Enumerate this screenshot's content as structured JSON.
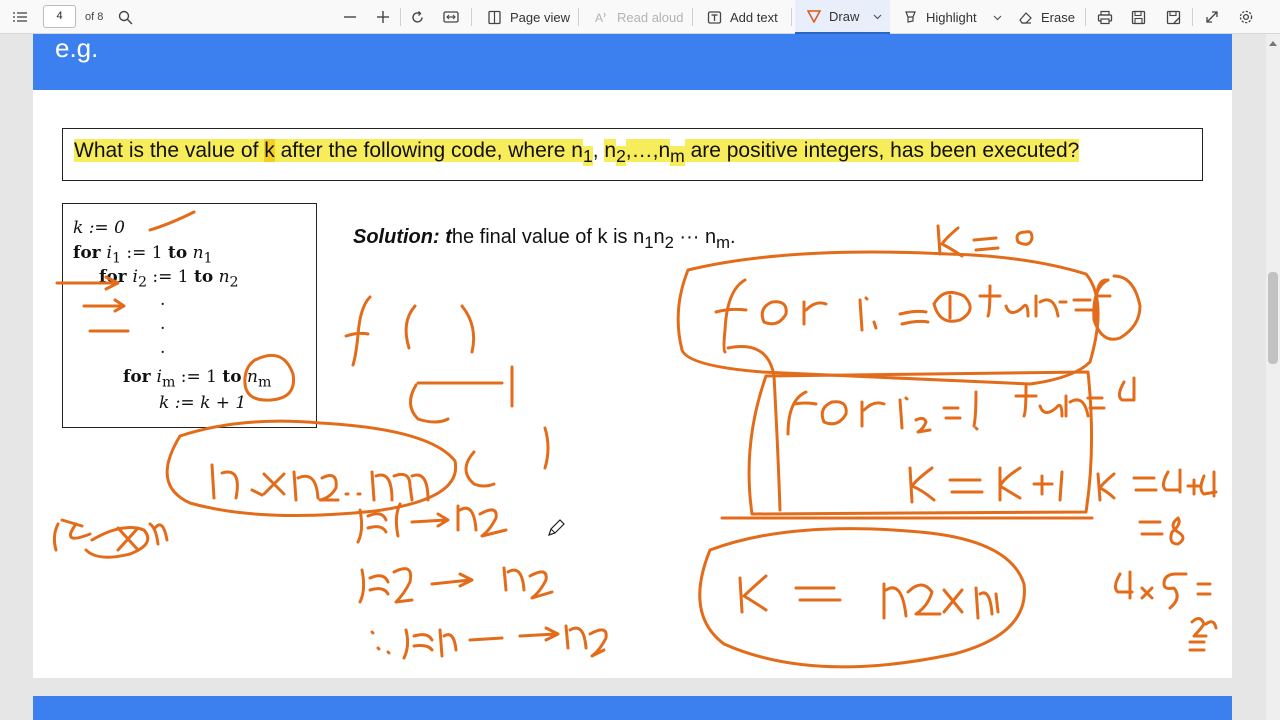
{
  "toolbar": {
    "page_number": "4",
    "page_total": "of 8",
    "page_view": "Page view",
    "read_aloud": "Read aloud",
    "add_text": "Add text",
    "draw": "Draw",
    "highlight": "Highlight",
    "erase": "Erase"
  },
  "slide": {
    "heading": "e.g.",
    "question": {
      "p1": "What is the value of ",
      "k": "k",
      "p2": " after the following code, where ",
      "n1": "n",
      "n1sub": "1",
      "comma1": ", ",
      "n2": "n",
      "n2sub": "2",
      "dots": ",…,",
      "nm": "n",
      "nmsub": "m",
      "p3": " are positive integers, has been executed?"
    },
    "code": {
      "l1": "k := 0",
      "l2a": "for ",
      "l2b": "i",
      "l2c": "1",
      "l2d": " := 1 ",
      "l2e": "to",
      "l2f": " n",
      "l2g": "1",
      "l3a": "for ",
      "l3b": "i",
      "l3c": "2",
      "l3d": " := 1 ",
      "l3e": "to",
      "l3f": " n",
      "l3g": "2",
      "dot": ".",
      "l4a": "for ",
      "l4b": "i",
      "l4c": "m",
      "l4d": " := 1 ",
      "l4e": "to",
      "l4f": " n",
      "l4g": "m",
      "l5": "k := k + 1"
    },
    "solution": {
      "label": "Solution: t",
      "text": "he final value of k is n",
      "s1": "1",
      "n2": "n",
      "s2": "2",
      "mid": " ··· n",
      "sm": "m",
      "end": "."
    }
  },
  "ink_color": "#e36c1b",
  "accent_color": "#3c80f0"
}
